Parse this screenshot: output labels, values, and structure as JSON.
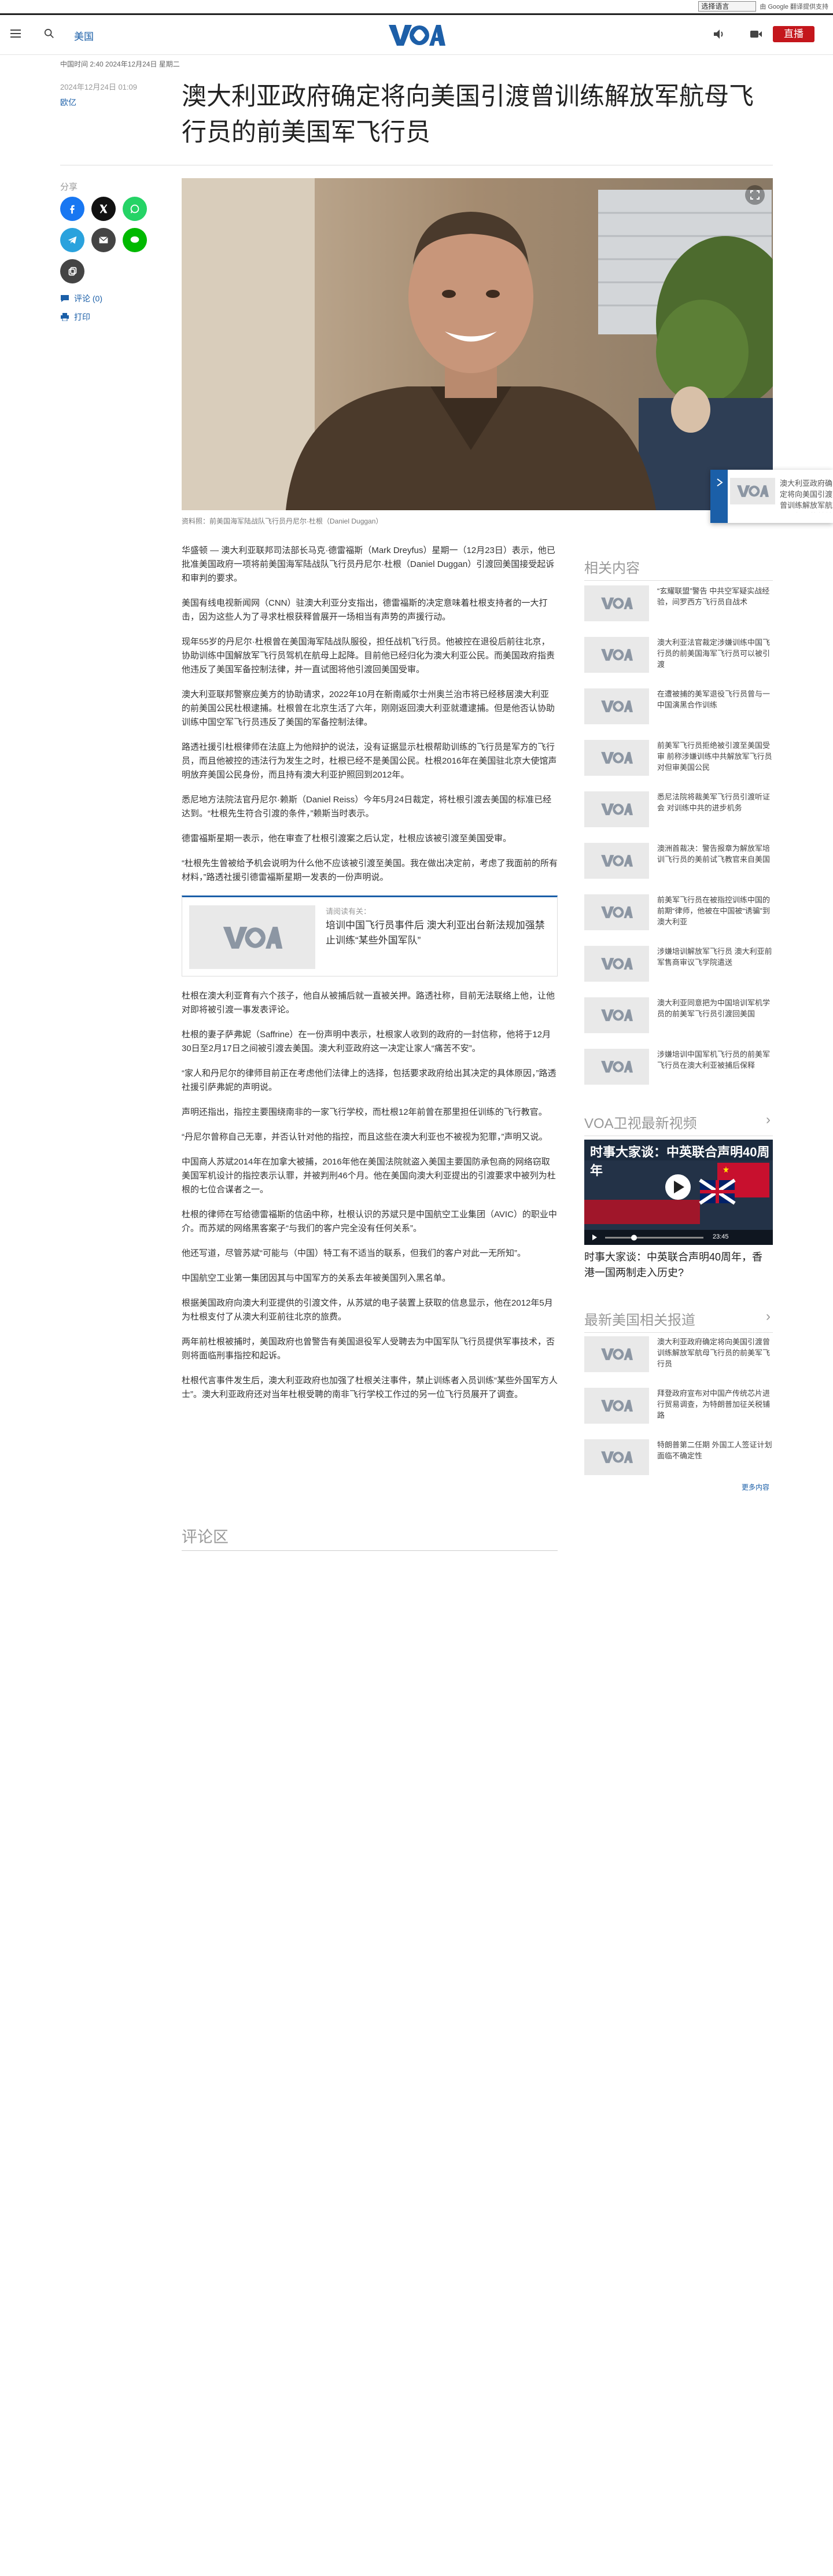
{
  "translate": {
    "select_value": "选择语言",
    "powered_by": "由 Google 翻译提供支持",
    "google": "Google"
  },
  "header": {
    "section": "美国",
    "logo_alt": "VOA",
    "live_label": "直播"
  },
  "article": {
    "updated_line": "中国时间 2:40 2024年12月24日 星期二",
    "date": "2024年12月24日 01:09",
    "byline": "欧亿",
    "headline": "澳大利亚政府确定将向美国引渡曾训练解放军航母飞行员的前美国军飞行员",
    "share_label": "分享",
    "comments_link": "评论 (0)",
    "print_link": "打印",
    "caption": "资料照：前美国海军陆战队飞行员丹尼尔·杜根（Daniel Duggan）",
    "paragraphs_a": [
      "华盛顿 — 澳大利亚联邦司法部长马克·德雷福斯（Mark Dreyfus）星期一（12月23日）表示，他已批准美国政府一项将前美国海军陆战队飞行员丹尼尔·杜根（Daniel Duggan）引渡回美国接受起诉和审判的要求。",
      "美国有线电视新闻网（CNN）驻澳大利亚分支指出，德雷福斯的决定意味着杜根支持者的一大打击，因为这些人为了寻求杜根获释曾展开一场相当有声势的声援行动。",
      "现年55岁的丹尼尔·杜根曾在美国海军陆战队服役，担任战机飞行员。他被控在退役后前往北京，协助训练中国解放军飞行员驾机在航母上起降。目前他已经归化为澳大利亚公民。而美国政府指责他违反了美国军备控制法律，并一直试图将他引渡回美国受审。",
      "澳大利亚联邦警察应美方的协助请求，2022年10月在新南威尔士州奥兰治市将已经移居澳大利亚的前美国公民杜根逮捕。杜根曾在北京生活了六年，刚刚返回澳大利亚就遭逮捕。但是他否认协助训练中国空军飞行员违反了美国的军备控制法律。",
      "路透社援引杜根律师在法庭上为他辩护的说法，没有证据显示杜根帮助训练的飞行员是军方的飞行员，而且他被控的违法行为发生之时，杜根已经不是美国公民。杜根2016年在美国驻北京大使馆声明放弃美国公民身份，而且持有澳大利亚护照回到2012年。",
      "悉尼地方法院法官丹尼尔·赖斯（Daniel Reiss）今年5月24日裁定，将杜根引渡去美国的标准已经达到。“杜根先生符合引渡的条件，”赖斯当时表示。",
      "德雷福斯星期一表示，他在审查了杜根引渡案之后认定，杜根应该被引渡至美国受审。",
      "“杜根先生曾被给予机会说明为什么他不应该被引渡至美国。我在做出决定前，考虑了我面前的所有材料，”路透社援引德雷福斯星期一发表的一份声明说。"
    ],
    "related_inline": {
      "label": "请阅读有关：",
      "title": "培训中国飞行员事件后 澳大利亚出台新法规加强禁止训练“某些外国军队”"
    },
    "paragraphs_b": [
      "杜根在澳大利亚育有六个孩子，他自从被捕后就一直被关押。路透社称，目前无法联络上他，让他对即将被引渡一事发表评论。",
      "杜根的妻子萨弗妮（Saffrine）在一份声明中表示，杜根家人收到的政府的一封信称，他将于12月30日至2月17日之间被引渡去美国。澳大利亚政府这一决定让家人“痛苦不安”。",
      "“家人和丹尼尔的律师目前正在考虑他们法律上的选择，包括要求政府给出其决定的具体原因，”路透社援引萨弗妮的声明说。",
      "声明还指出，指控主要围绕南非的一家飞行学校，而杜根12年前曾在那里担任训练的飞行教官。",
      "“丹尼尔曾称自己无辜，并否认针对他的指控，而且这些在澳大利亚也不被视为犯罪，”声明又说。",
      "中国商人苏斌2014年在加拿大被捕，2016年他在美国法院就盗入美国主要国防承包商的网络窃取美国军机设计的指控表示认罪，并被判刑46个月。他在美国向澳大利亚提出的引渡要求中被列为杜根的七位合谋者之一。",
      "杜根的律师在写给德雷福斯的信函中称，杜根认识的苏斌只是中国航空工业集团（AVIC）的职业中介。而苏斌的网络黑客案子“与我们的客户完全没有任何关系”。",
      "他还写道，尽管苏斌“可能与（中国）特工有不适当的联系，但我们的客户对此一无所知”。",
      "中国航空工业第一集团因其与中国军方的关系去年被美国列入黑名单。",
      "根据美国政府向澳大利亚提供的引渡文件，从苏斌的电子装置上获取的信息显示，他在2012年5月为杜根支付了从澳大利亚前往北京的旅费。",
      "两年前杜根被捕时，美国政府也曾警告有美国退役军人受聘去为中国军队飞行员提供军事技术，否则将面临刑事指控和起诉。",
      "杜根代言事件发生后，澳大利亚政府也加强了杜根关注事件，禁止训练者入员训练“某些外国军方人士”。澳大利亚政府还对当年杜根受聘的南非飞行学校工作过的另一位飞行员展开了调查。"
    ],
    "comments_title": "评论区"
  },
  "promo": {
    "text": "澳大利亚政府确定将向美国引渡曾训练解放军航母飞行员的前美军飞行员"
  },
  "sidebar": {
    "related_title": "相关内容",
    "related_items": [
      "“玄耀联盟”警告 中共空军疑实战经验，间罗西方飞行员自战术",
      "澳大利亚法官裁定涉嫌训练中国飞行员的前美国海军飞行员可以被引渡",
      "在遭被捕的美军退役飞行员曾与一中国演黑合作训练",
      "前美军飞行员拒绝被引渡至美国受审 前称涉嫌训练中共解放军飞行员对但审美国公民",
      "悉尼法院将裁美军飞行员引渡听证会 对训练中共的进步机务",
      "澳洲首裁决：警告报章为解放军培训飞行员的美前试飞教官来自美国",
      "前美军飞行员在被指控训练中国的前期“律师，他被在中国被“诱骗”到澳大利亚",
      "涉嫌培训解放军飞行员 澳大利亚前军售商审议飞学院遣送",
      "澳大利亚同意把为中国培训军机学员的前美军飞行员引渡回美国",
      "涉嫌培训中国军机飞行员的前美军飞行员在澳大利亚被捕后保释"
    ],
    "video_title": "VOA卫视最新视频",
    "video_overlay_top": "时事大家谈：中英联合声明40周年",
    "video_time": "23:45",
    "video_caption": "时事大家谈：中英联合声明40周年，香港一国两制走入历史?",
    "latest_title": "最新美国相关报道",
    "latest_items": [
      "澳大利亚政府确定将向美国引渡曾训练解放军航母飞行员的前美军飞行员",
      "拜登政府宣布对中国产传统芯片进行贸易调查，为特朗普加征关税铺路",
      "特朗普第二任期 外国工人签证计划面临不确定性"
    ],
    "more_label": "更多内容"
  },
  "colors": {
    "brand_blue": "#1b5fa8",
    "live_red": "#c4161c",
    "logo_blue": "#1d5fa8"
  }
}
